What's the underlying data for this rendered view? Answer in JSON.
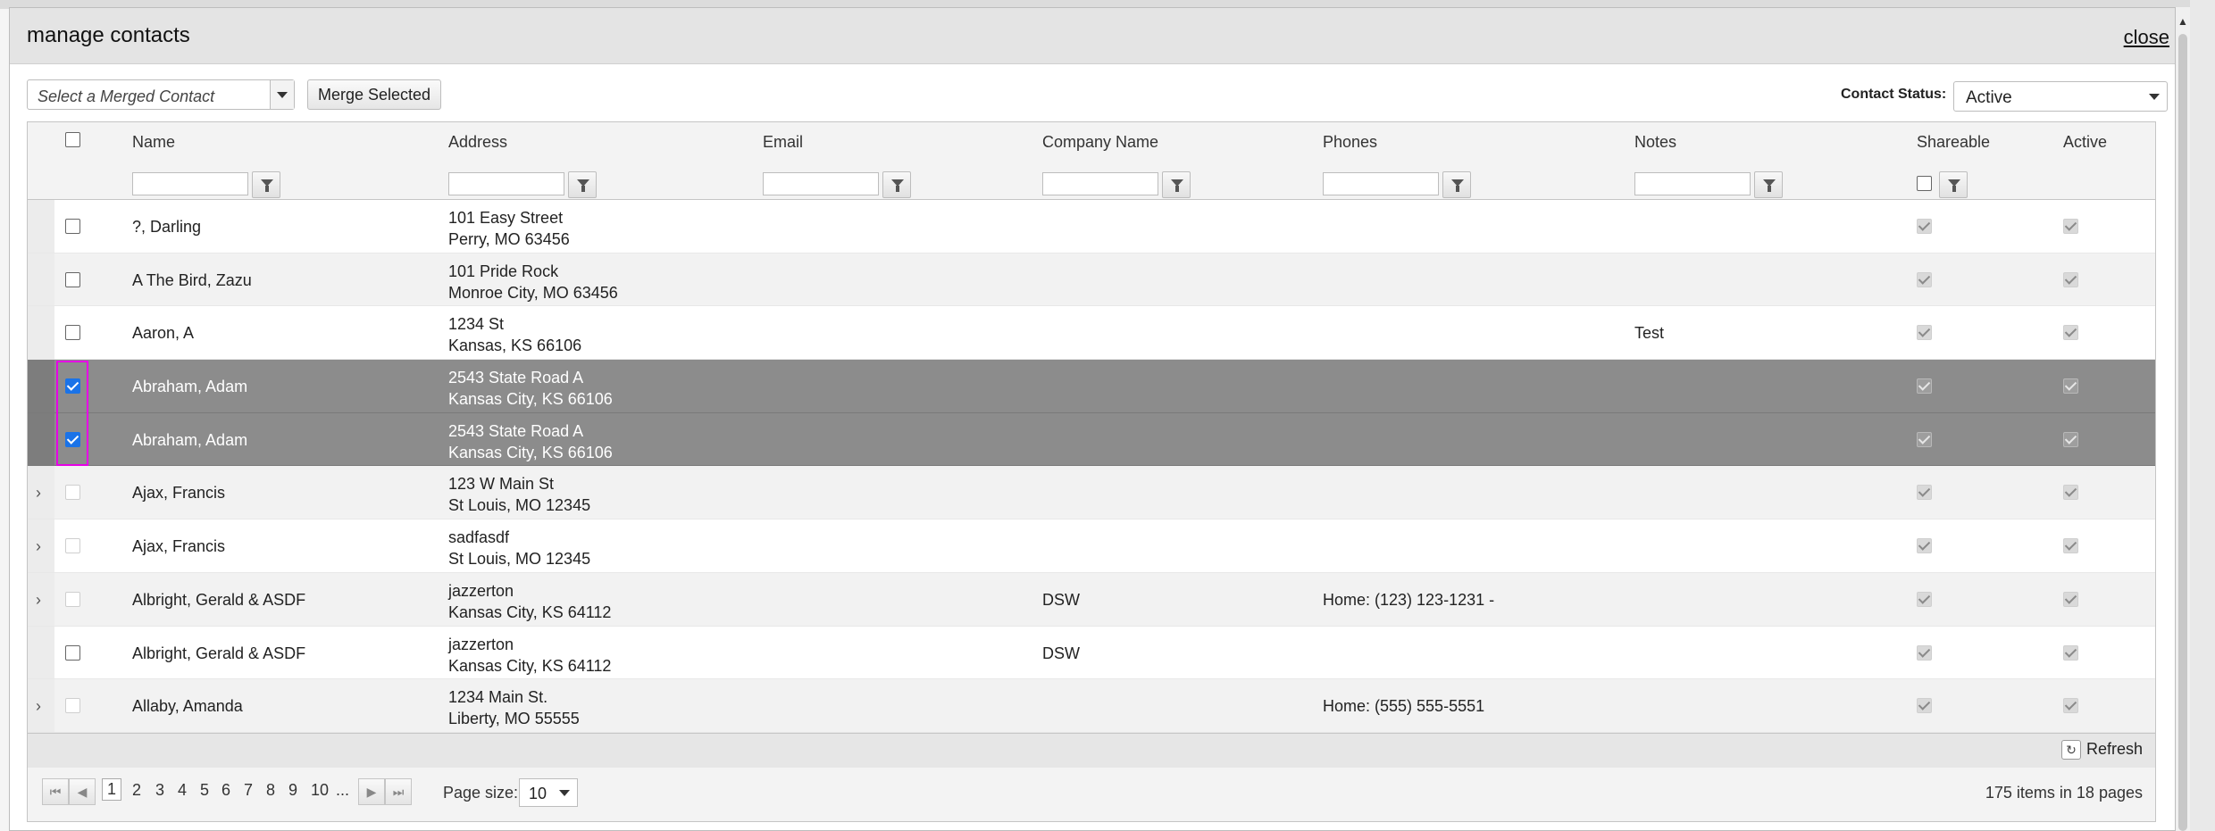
{
  "dialog": {
    "title": "manage contacts",
    "close_label": "close"
  },
  "toolbar": {
    "merge_placeholder": "Select a Merged Contact",
    "merge_button": "Merge Selected",
    "status_label": "Contact Status:",
    "status_value": "Active"
  },
  "columns": [
    "Name",
    "Address",
    "Email",
    "Company Name",
    "Phones",
    "Notes",
    "Shareable",
    "Active"
  ],
  "rows": [
    {
      "name": "?, Darling",
      "addr1": "101 Easy Street",
      "addr2": "Perry, MO 63456",
      "company": "",
      "phone": "",
      "notes": "",
      "selected": false,
      "expandable": false
    },
    {
      "name": "A The Bird, Zazu",
      "addr1": "101 Pride Rock",
      "addr2": "Monroe City, MO 63456",
      "company": "",
      "phone": "",
      "notes": "",
      "selected": false,
      "expandable": false
    },
    {
      "name": "Aaron, A",
      "addr1": "1234 St",
      "addr2": "Kansas, KS 66106",
      "company": "",
      "phone": "",
      "notes": "Test",
      "selected": false,
      "expandable": false
    },
    {
      "name": "Abraham, Adam",
      "addr1": "2543 State Road A",
      "addr2": "Kansas City, KS 66106",
      "company": "",
      "phone": "",
      "notes": "",
      "selected": true,
      "expandable": false
    },
    {
      "name": "Abraham, Adam",
      "addr1": "2543 State Road A",
      "addr2": "Kansas City, KS 66106",
      "company": "",
      "phone": "",
      "notes": "",
      "selected": true,
      "expandable": false
    },
    {
      "name": "Ajax, Francis",
      "addr1": "123 W Main St",
      "addr2": "St Louis, MO 12345",
      "company": "",
      "phone": "",
      "notes": "",
      "selected": false,
      "expandable": true
    },
    {
      "name": "Ajax, Francis",
      "addr1": "sadfasdf",
      "addr2": "St Louis, MO 12345",
      "company": "",
      "phone": "",
      "notes": "",
      "selected": false,
      "expandable": true
    },
    {
      "name": "Albright, Gerald & ASDF",
      "addr1": "jazzerton",
      "addr2": "Kansas City, KS 64112",
      "company": "DSW",
      "phone": "Home: (123) 123-1231 -",
      "notes": "",
      "selected": false,
      "expandable": true
    },
    {
      "name": "Albright, Gerald & ASDF",
      "addr1": "jazzerton",
      "addr2": "Kansas City, KS 64112",
      "company": "DSW",
      "phone": "",
      "notes": "",
      "selected": false,
      "expandable": false
    },
    {
      "name": "Allaby, Amanda",
      "addr1": "1234 Main St.",
      "addr2": "Liberty, MO 55555",
      "company": "",
      "phone": "Home: (555) 555-5551",
      "notes": "",
      "selected": false,
      "expandable": true
    }
  ],
  "footer": {
    "refresh_label": "Refresh"
  },
  "pager": {
    "pages": [
      "1",
      "2",
      "3",
      "4",
      "5",
      "6",
      "7",
      "8",
      "9",
      "10",
      "..."
    ],
    "current_page": "1",
    "page_size_label": "Page size:",
    "page_size": "10",
    "info": "175 items in 18 pages"
  },
  "colors": {
    "selected_row": "#8c8c8c",
    "selection_highlight": "#e600e6",
    "checkbox_checked": "#1a73e8"
  }
}
